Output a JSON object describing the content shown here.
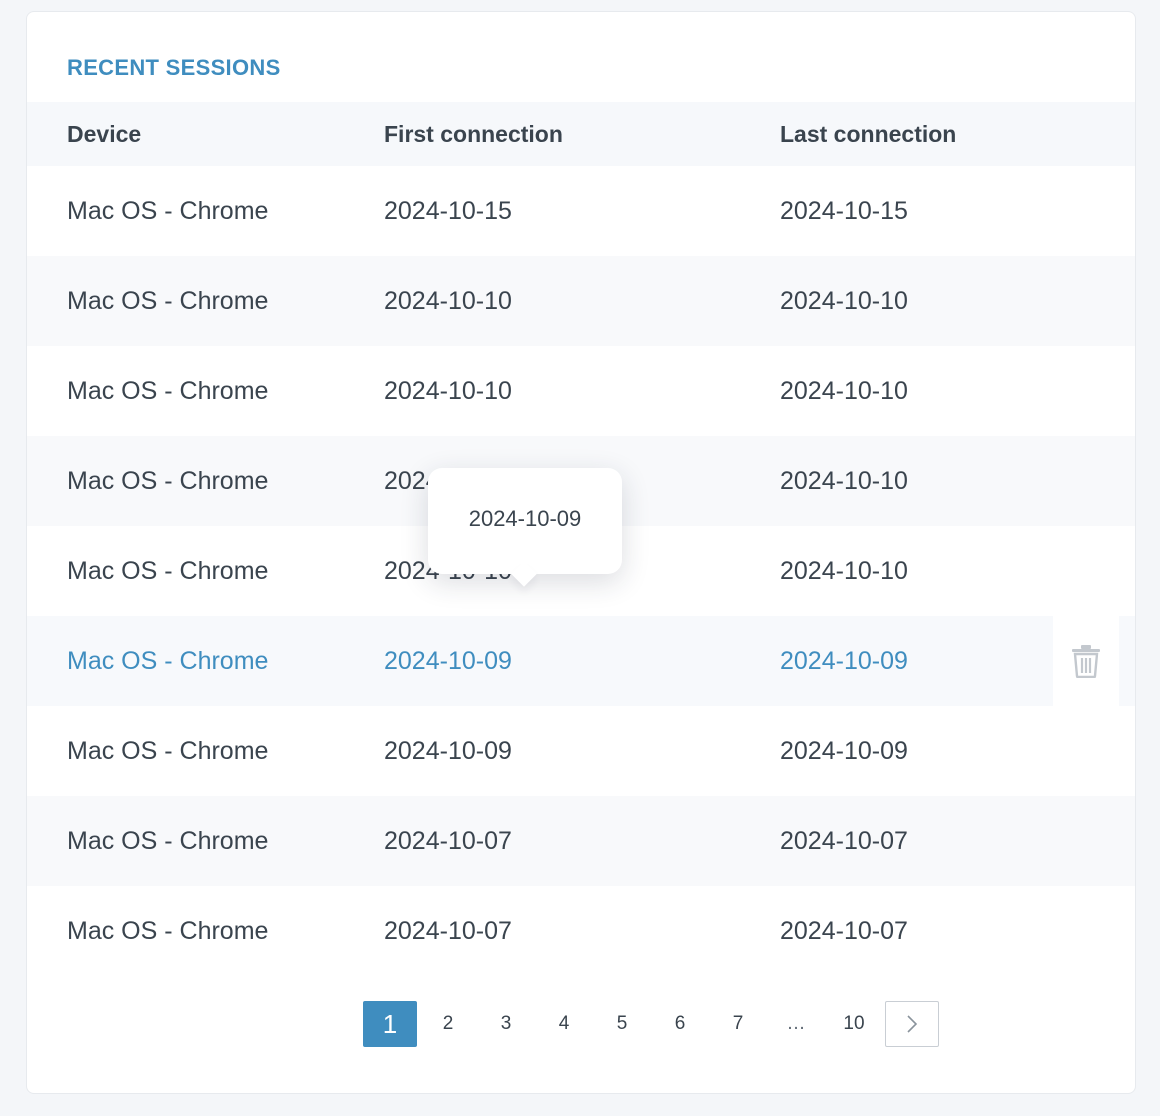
{
  "section_title": "RECENT SESSIONS",
  "table": {
    "headers": {
      "device": "Device",
      "first_connection": "First connection",
      "last_connection": "Last connection"
    },
    "rows": [
      {
        "device": "Mac OS - Chrome",
        "first": "2024-10-15",
        "last": "2024-10-15"
      },
      {
        "device": "Mac OS - Chrome",
        "first": "2024-10-10",
        "last": "2024-10-10"
      },
      {
        "device": "Mac OS - Chrome",
        "first": "2024-10-10",
        "last": "2024-10-10"
      },
      {
        "device": "Mac OS - Chrome",
        "first": "2024-10-10",
        "last": "2024-10-10"
      },
      {
        "device": "Mac OS - Chrome",
        "first": "2024-10-10",
        "last": "2024-10-10"
      },
      {
        "device": "Mac OS - Chrome",
        "first": "2024-10-09",
        "last": "2024-10-09"
      },
      {
        "device": "Mac OS - Chrome",
        "first": "2024-10-09",
        "last": "2024-10-09"
      },
      {
        "device": "Mac OS - Chrome",
        "first": "2024-10-07",
        "last": "2024-10-07"
      },
      {
        "device": "Mac OS - Chrome",
        "first": "2024-10-07",
        "last": "2024-10-07"
      }
    ],
    "hovered_row_index": 5,
    "row_action_icon": "trash-icon"
  },
  "tooltip": {
    "text": "2024-10-09"
  },
  "pagination": {
    "pages": [
      "1",
      "2",
      "3",
      "4",
      "5",
      "6",
      "7",
      "…",
      "10"
    ],
    "current": "1",
    "next_icon": "chevron-right-icon"
  },
  "colors": {
    "accent": "#3f8dbf",
    "text": "#3a444e",
    "header_bg": "#f6f8fb",
    "icon_muted": "#c3c8ce"
  }
}
